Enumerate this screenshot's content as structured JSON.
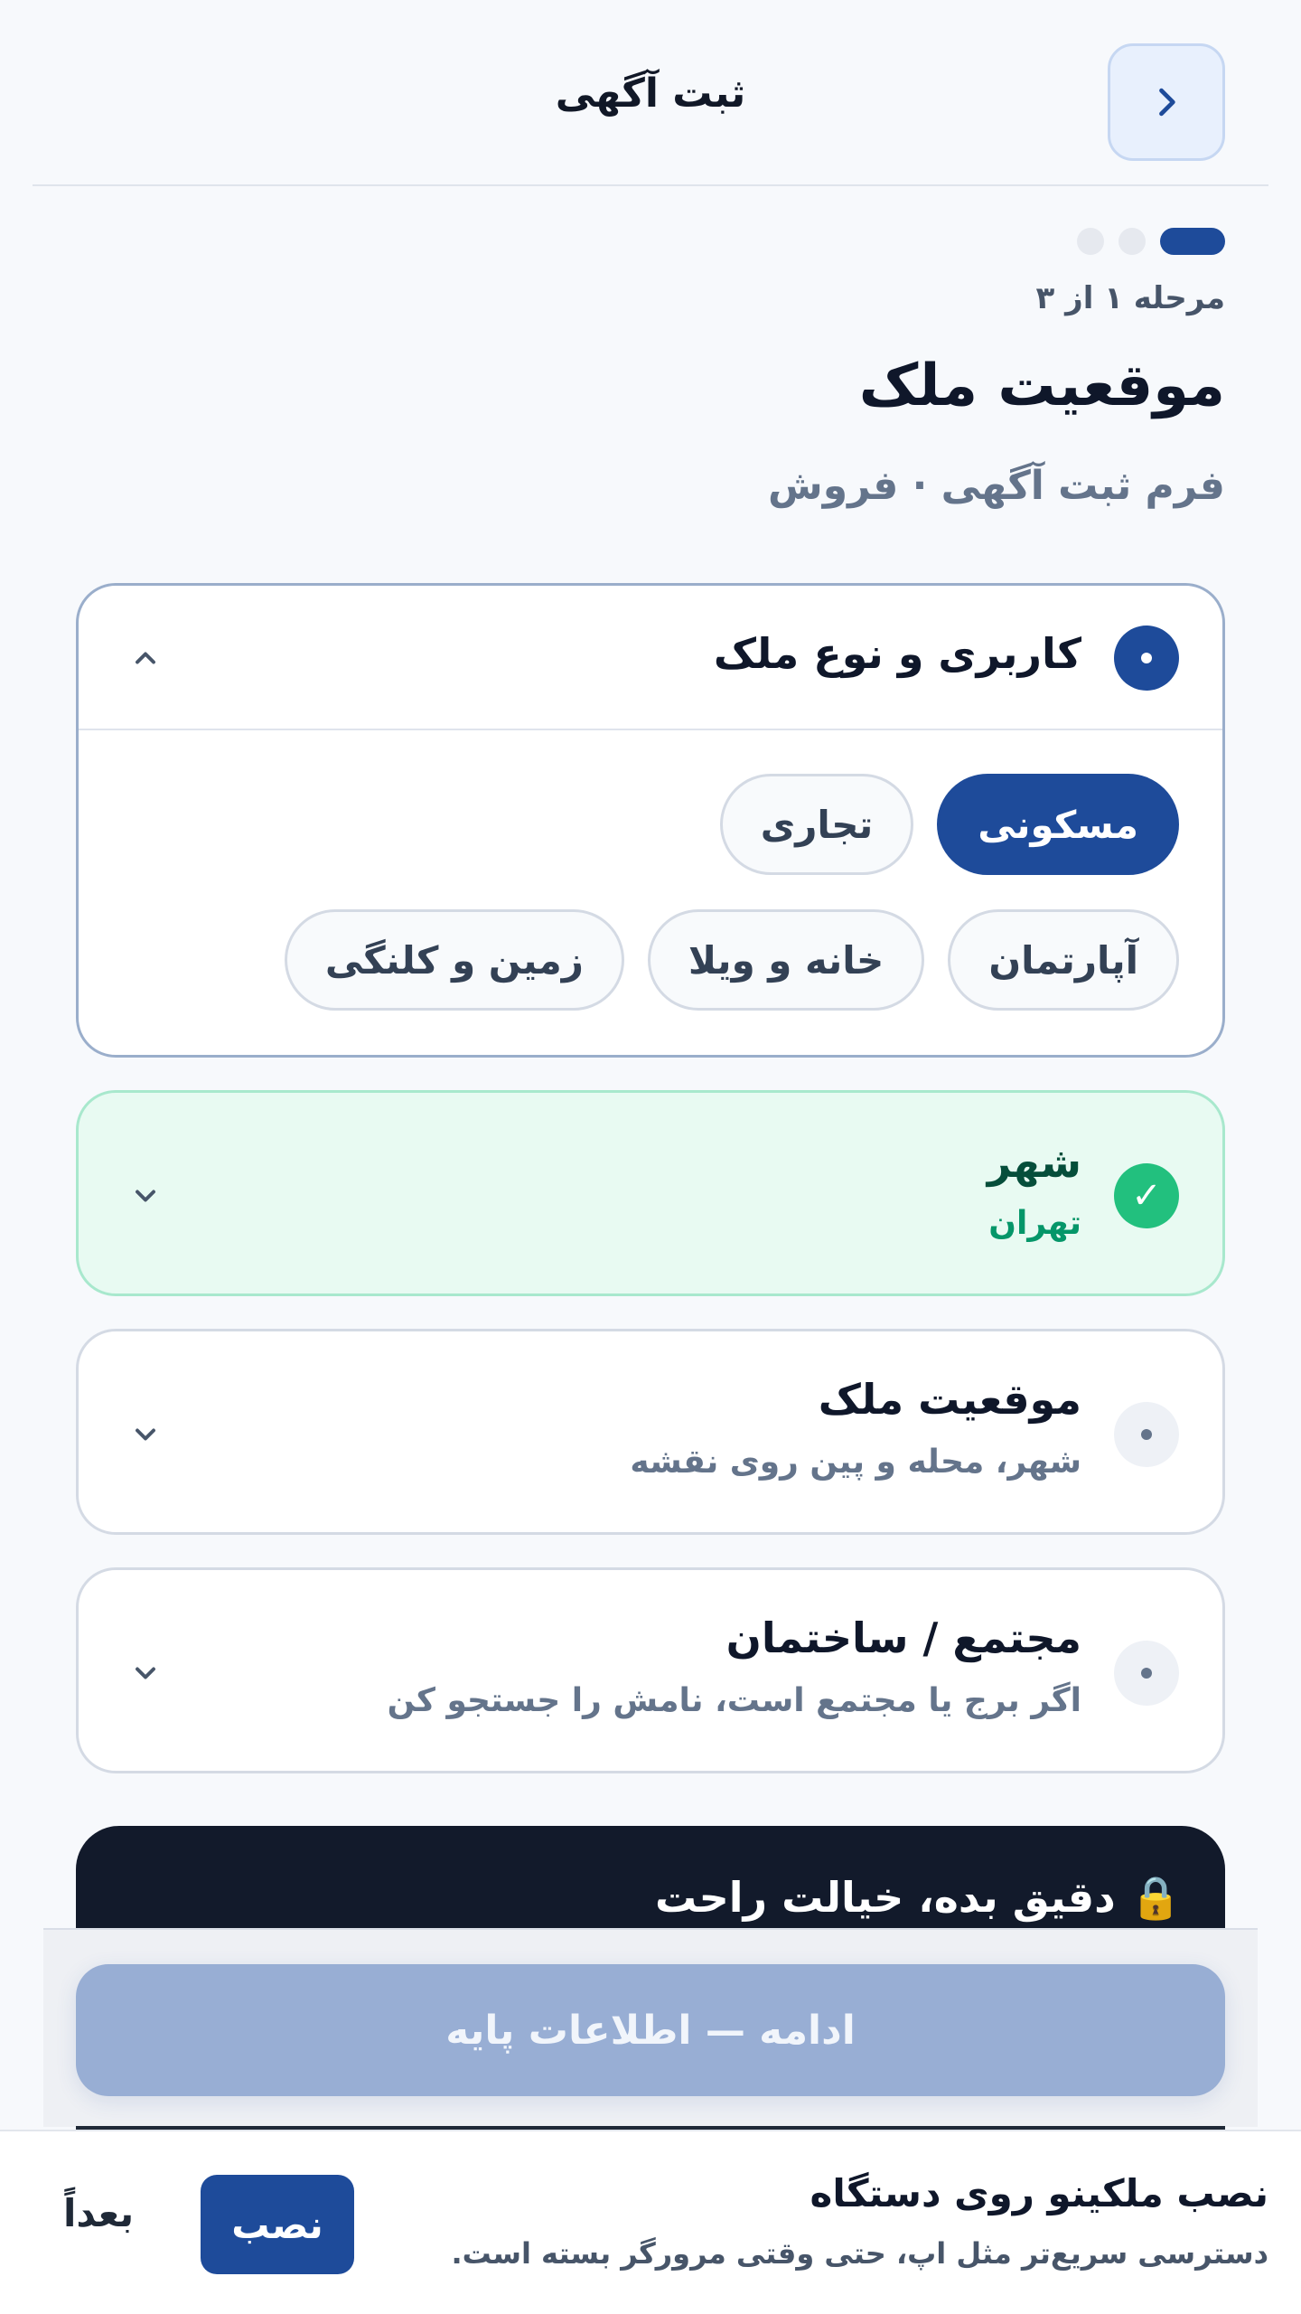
{
  "header": {
    "title": "ثبت آگهی",
    "back_icon": "chevron-right-icon"
  },
  "stepper": {
    "current": 1,
    "total": 3,
    "label": "مرحله ۱ از ۳"
  },
  "page": {
    "title": "موقعیت ملک",
    "subtitle": "فرم ثبت آگهی · فروش"
  },
  "sections": {
    "usage": {
      "title": "کاربری و نوع ملک",
      "state": "open",
      "usage_options": [
        "مسکونی",
        "تجاری"
      ],
      "selected_usage": "مسکونی",
      "type_options": [
        "آپارتمان",
        "خانه و ویلا",
        "زمین و کلنگی"
      ]
    },
    "city": {
      "title": "شهر",
      "value": "تهران",
      "state": "done",
      "check": "✓"
    },
    "location": {
      "title": "موقعیت ملک",
      "subtitle": "شهر، محله و پین روی نقشه",
      "state": "pending"
    },
    "complex": {
      "title": "مجتمع / ساختمان",
      "subtitle": "اگر برج یا مجتمع است، نامش را جستجو کن",
      "state": "pending"
    }
  },
  "promo": {
    "icon": "lock-icon",
    "text": "🔒 دقیق بده، خیالت راحت"
  },
  "continue": {
    "label": "ادامه — اطلاعات پایه",
    "disabled": true
  },
  "install_prompt": {
    "title": "نصب ملکینو روی دستگاه",
    "description": "دسترسی سریع‌تر مثل اپ، حتی وقتی مرورگر بسته است.",
    "install_label": "نصب",
    "later_label": "بعداً"
  },
  "colors": {
    "primary": "#1e4b9a",
    "success": "#22c07e",
    "success_bg": "#e8faf2",
    "dark": "#121a2b",
    "disabled_button": "#98aed4"
  }
}
